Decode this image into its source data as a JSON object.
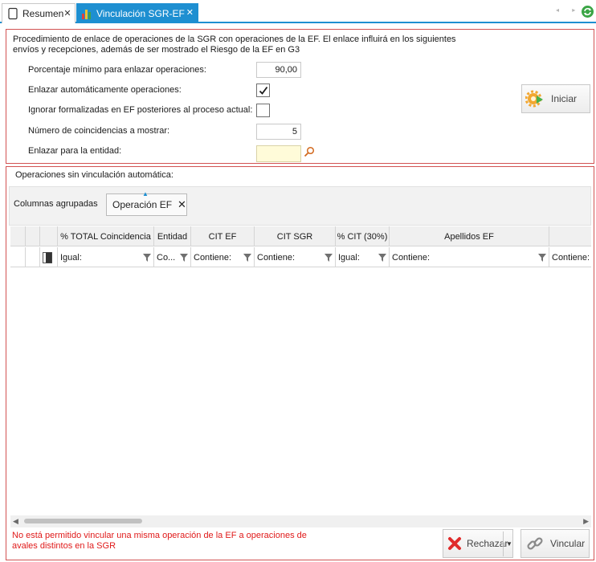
{
  "tabs": [
    {
      "label": "Resumen",
      "icon": "document-icon",
      "active": false
    },
    {
      "label": "Vinculación SGR-EF",
      "icon": "chart-icon",
      "active": true
    }
  ],
  "tab_close_glyph": "✕",
  "strip_arrows": "◂ ▸",
  "accent_color": "#1e8fd1",
  "panel_border_color": "#d25252",
  "settings": {
    "description": "Procedimiento de enlace de operaciones de la SGR con operaciones de la EF. El enlace influirá en los siguientes envíos y recepciones, además de ser mostrado el Riesgo de la EF en G3",
    "min_percent_label": "Porcentaje mínimo para enlazar operaciones:",
    "min_percent_value": "90,00",
    "auto_link_label": "Enlazar automáticamente operaciones:",
    "auto_link_checked": true,
    "ignore_formalized_label": "Ignorar formalizadas en EF posteriores al proceso actual:",
    "ignore_formalized_checked": false,
    "matches_label": "Número de coincidencias a mostrar:",
    "matches_value": "5",
    "entity_label": "Enlazar para la entidad:",
    "entity_value": "",
    "start_button": "Iniciar"
  },
  "operations": {
    "title": "Operaciones sin vinculación automática:",
    "grouped_columns_label": "Columnas agrupadas",
    "group_chip": "Operación EF",
    "columns": [
      "% TOTAL Coincidencia",
      "Entidad",
      "CIT EF",
      "CIT SGR",
      "% CIT (30%)",
      "Apellidos EF",
      ""
    ],
    "filters": [
      "Igual:",
      "Co...",
      "Contiene:",
      "Contiene:",
      "Igual:",
      "Contiene:",
      "Contiene:"
    ],
    "rows": []
  },
  "warning": "No está permitido vincular una misma operación de la EF a operaciones de avales distintos en la SGR",
  "buttons": {
    "reject": "Rechazar",
    "link": "Vincular"
  }
}
